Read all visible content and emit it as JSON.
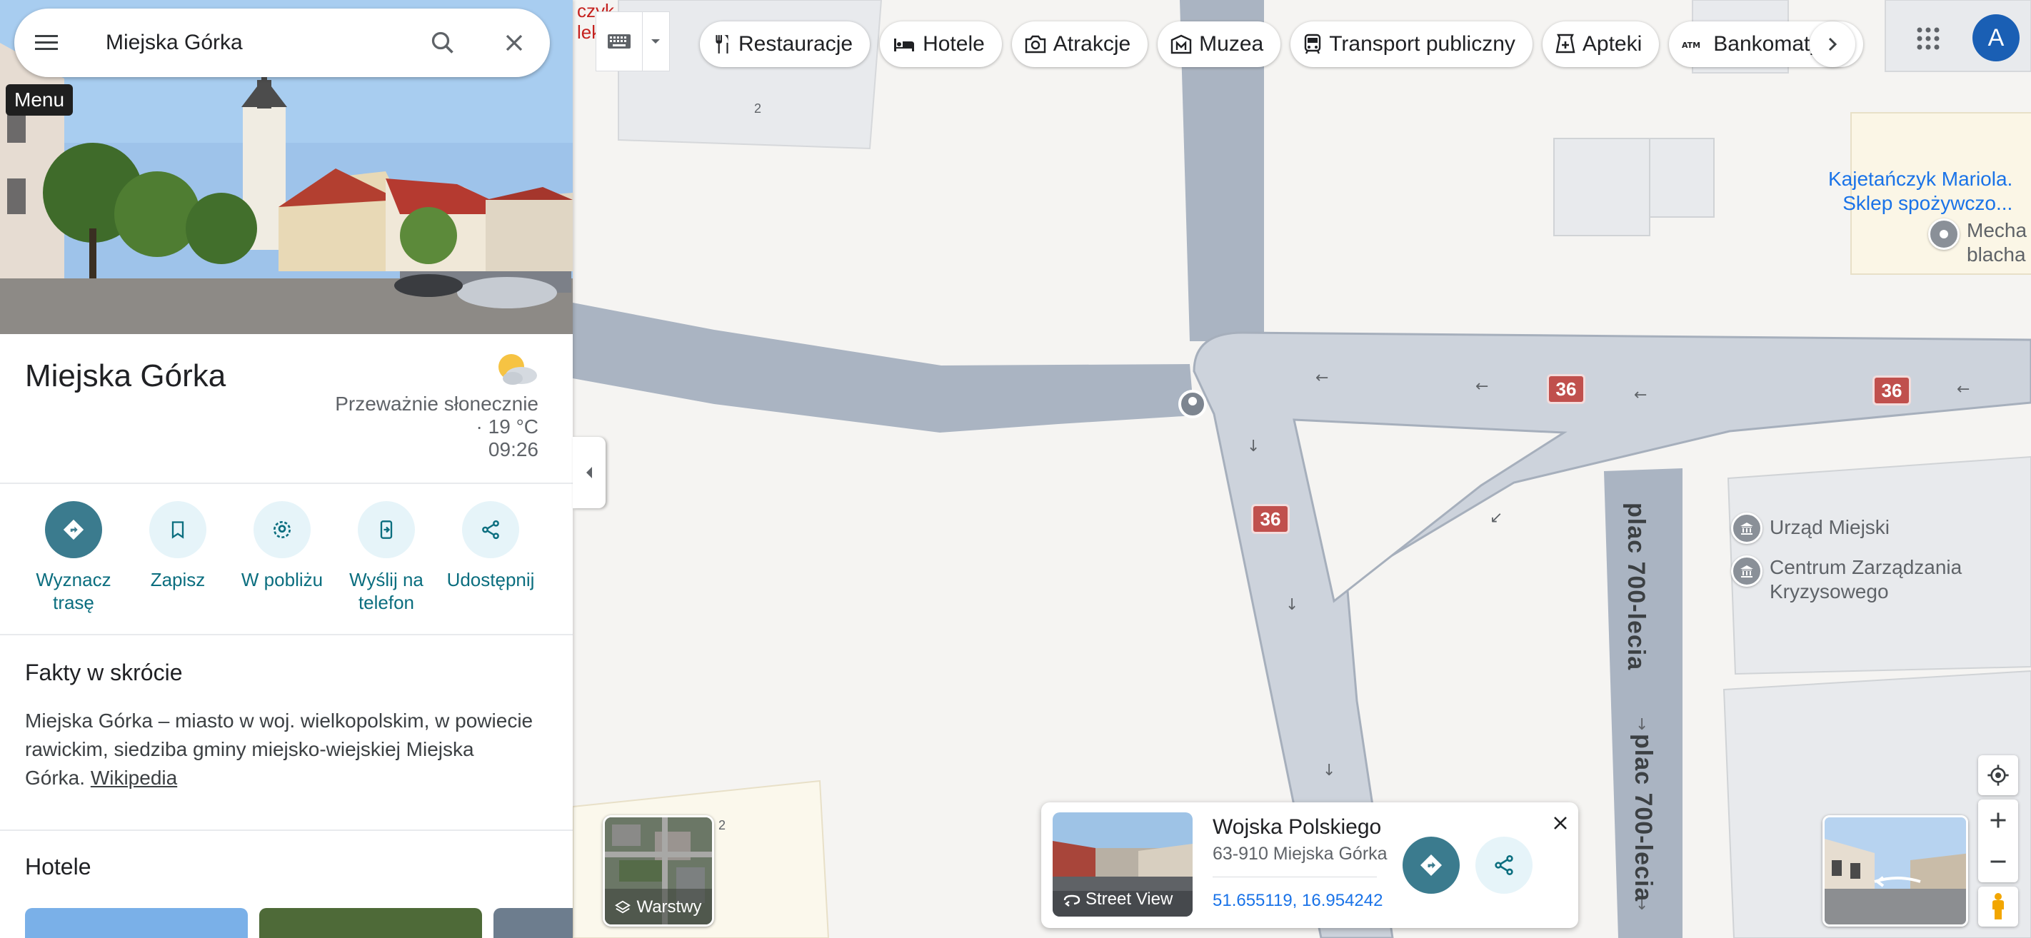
{
  "search": {
    "value": "Miejska Górka"
  },
  "tooltip": {
    "menu": "Menu"
  },
  "place": {
    "title": "Miejska Górka",
    "weather_text": "Przeważnie słonecznie",
    "temperature": "· 19 °C",
    "time": "09:26",
    "weather_icon": "partly-sunny-icon"
  },
  "actions": [
    {
      "label": "Wyznacz trasę",
      "icon": "directions-icon"
    },
    {
      "label": "Zapisz",
      "icon": "bookmark-icon"
    },
    {
      "label": "W pobliżu",
      "icon": "nearby-icon"
    },
    {
      "label": "Wyślij na telefon",
      "icon": "send-to-phone-icon"
    },
    {
      "label": "Udostępnij",
      "icon": "share-icon"
    }
  ],
  "facts": {
    "title": "Fakty w skrócie",
    "text": "Miejska Górka – miasto w woj. wielkopolskim, w powiecie rawickim, siedziba gminy miejsko-wiejskiej Miejska Górka.",
    "link": "Wikipedia"
  },
  "hotels": {
    "title": "Hotele"
  },
  "chips": [
    {
      "label": "Restauracje",
      "icon": "restaurant-icon"
    },
    {
      "label": "Hotele",
      "icon": "hotel-icon"
    },
    {
      "label": "Atrakcje",
      "icon": "camera-icon"
    },
    {
      "label": "Muzea",
      "icon": "museum-icon"
    },
    {
      "label": "Transport publiczny",
      "icon": "transit-icon"
    },
    {
      "label": "Apteki",
      "icon": "pharmacy-icon"
    },
    {
      "label": "Bankomaty",
      "icon": "atm-icon"
    }
  ],
  "account": {
    "initial": "A"
  },
  "map": {
    "route_number": "36",
    "street_name": "plac 700-lecia",
    "building_number": "2",
    "red_text_1": "czyk",
    "red_text_2": "lek",
    "pois": {
      "shop_line1": "Kajetańczyk Mariola.",
      "shop_line2": "Sklep spożywczo...",
      "mech_line1": "Mecha",
      "mech_line2": "blacha",
      "townhall": "Urząd Miejski",
      "crisis_line1": "Centrum Zarządzania",
      "crisis_line2": "Kryzysowego"
    }
  },
  "layers": {
    "label": "Warstwy"
  },
  "info_card": {
    "title": "Wojska Polskiego",
    "address": "63-910 Miejska Górka",
    "coords": "51.655119, 16.954242",
    "street_view_label": "Street View"
  },
  "colors": {
    "accent": "#3b7b8e",
    "route": "#c0504d",
    "link": "#1a73e8",
    "road": "#cdd3dc"
  }
}
